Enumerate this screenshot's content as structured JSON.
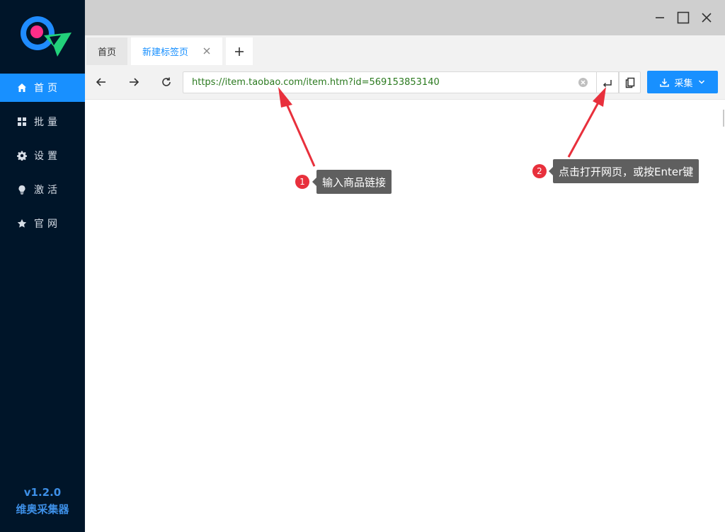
{
  "app": {
    "version": "v1.2.0",
    "name": "维奥采集器"
  },
  "sidebar": {
    "items": [
      {
        "label": "首页",
        "icon": "home-icon",
        "active": true
      },
      {
        "label": "批量",
        "icon": "grid-icon",
        "active": false
      },
      {
        "label": "设置",
        "icon": "gear-icon",
        "active": false
      },
      {
        "label": "激活",
        "icon": "bulb-icon",
        "active": false
      },
      {
        "label": "官网",
        "icon": "star-icon",
        "active": false
      }
    ]
  },
  "tabs": {
    "home_label": "首页",
    "active_label": "新建标签页"
  },
  "toolbar": {
    "url_value": "https://item.taobao.com/item.htm?id=569153853140",
    "collect_label": "采集"
  },
  "annotations": [
    {
      "number": "1",
      "text": "输入商品链接"
    },
    {
      "number": "2",
      "text": "点击打开网页，或按Enter键"
    }
  ],
  "colors": {
    "accent": "#1890ff",
    "sidebar_bg": "#001529",
    "url_text": "#2b7a1f",
    "annotation_red": "#e8303c"
  }
}
